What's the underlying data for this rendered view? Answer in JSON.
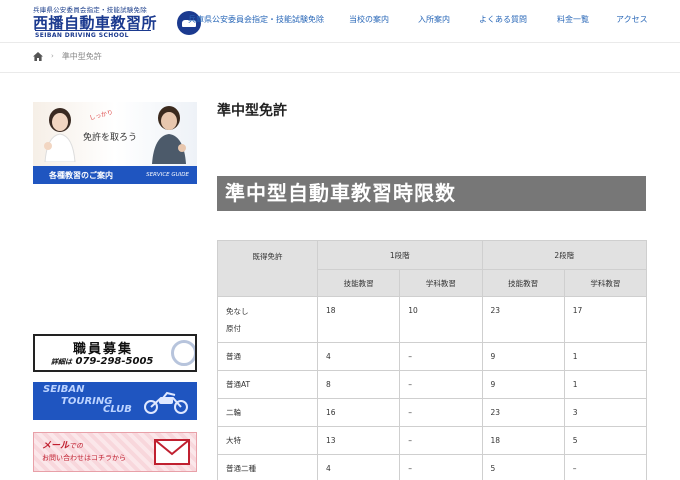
{
  "header": {
    "logo_sub": "兵庫県公安委員会指定・技能試験免除",
    "logo_main": "西播自動車教習所",
    "logo_en": "SEIBAN DRIVING SCHOOL",
    "nav": [
      {
        "label": "兵庫県公安委員会指定・技能試験免除"
      },
      {
        "label": "当校の案内"
      },
      {
        "label": "入所案内"
      },
      {
        "label": "よくある質問"
      },
      {
        "label": "料金一覧"
      },
      {
        "label": "アクセス"
      }
    ]
  },
  "breadcrumb": {
    "current": "準中型免許"
  },
  "sidebar": {
    "guide_banner": {
      "tag": "しっかり",
      "caption": "免許を取ろう",
      "bar_jp": "各種教習のご案内",
      "bar_en": "SERVICE GUIDE"
    },
    "recruit": {
      "title": "職員募集",
      "detail_label": "詳細は",
      "phone": "079-298-5005"
    },
    "touring": {
      "line1": "SEIBAN",
      "line2": "TOURING",
      "line3": "CLUB"
    },
    "mail": {
      "line1_main": "メール",
      "line1_small": "での",
      "line2": "お問い合わせはコチラから"
    }
  },
  "main": {
    "page_title": "準中型免許",
    "section_title": "準中型自動車教習時限数",
    "table": {
      "col_license": "既得免許",
      "stage1": "1段階",
      "stage2": "2段階",
      "practical": "技能教習",
      "academic": "学科教習",
      "rows": [
        {
          "license": "免なし",
          "license2": "原付",
          "s1_practical": "18",
          "s1_academic": "10",
          "s2_practical": "23",
          "s2_academic": "17"
        },
        {
          "license": "普通",
          "s1_practical": "4",
          "s1_academic": "–",
          "s2_practical": "9",
          "s2_academic": "1"
        },
        {
          "license": "普通AT",
          "s1_practical": "8",
          "s1_academic": "–",
          "s2_practical": "9",
          "s2_academic": "1"
        },
        {
          "license": "二輪",
          "s1_practical": "16",
          "s1_academic": "–",
          "s2_practical": "23",
          "s2_academic": "3"
        },
        {
          "license": "大特",
          "s1_practical": "13",
          "s1_academic": "–",
          "s2_practical": "18",
          "s2_academic": "5"
        },
        {
          "license": "普通二種",
          "s1_practical": "4",
          "s1_academic": "–",
          "s2_practical": "5",
          "s2_academic": "–"
        }
      ]
    }
  },
  "colors": {
    "brand_blue": "#1b3a8f",
    "nav_blue": "#2a68b8",
    "section_bar": "#777777",
    "table_header": "#e1e1e1"
  }
}
